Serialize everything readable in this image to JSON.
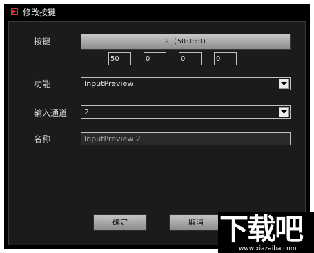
{
  "window": {
    "title": "修改按键"
  },
  "form": {
    "key_label": "按键",
    "key_value": "2 (50:0:0)",
    "key_fields": [
      "50",
      "0",
      "0",
      "0"
    ],
    "function_label": "功能",
    "function_value": "InputPreview",
    "channel_label": "输入通道",
    "channel_value": "2",
    "name_label": "名称",
    "name_value": "InputPreview 2"
  },
  "buttons": {
    "ok": "确定",
    "cancel": "取消"
  },
  "watermark": {
    "logo": "下载吧",
    "url": "www.xiazaiba.com"
  },
  "colors": {
    "title_icon": "#d0342c",
    "panel": "#1b1b1b"
  }
}
